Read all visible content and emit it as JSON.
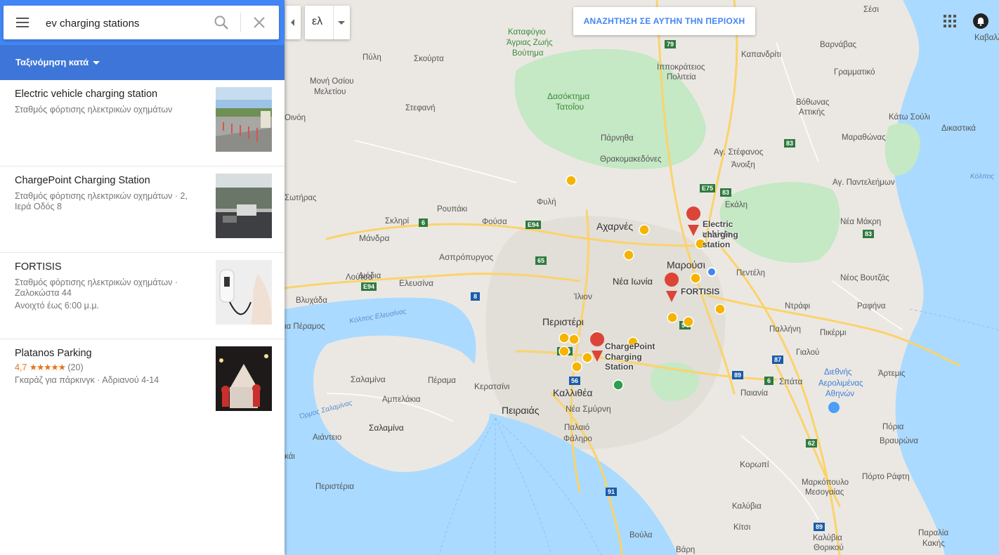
{
  "search": {
    "value": "ev charging stations"
  },
  "sort": {
    "label": "Ταξινόμηση κατά"
  },
  "results": [
    {
      "title": "Electric vehicle charging station",
      "line1": "Σταθμός φόρτισης ηλεκτρικών οχημάτων",
      "line2": "",
      "line3": ""
    },
    {
      "title": "ChargePoint Charging Station",
      "line1": "Σταθμός φόρτισης ηλεκτρικών οχημάτων · 2,",
      "line2": "Ιερά Οδός 8",
      "line3": ""
    },
    {
      "title": "FORTISIS",
      "line1": "Σταθμός φόρτισης ηλεκτρικών οχημάτων ·",
      "line2": "Ζαλοκώστα 44",
      "line3": "Ανοιχτό έως 6:00 μ.μ."
    },
    {
      "title": "Platanos Parking",
      "rating": "4,7",
      "stars": "★★★★★",
      "reviews": "(20)",
      "line2": "Γκαράζ για πάρκινγκ · Αδριανού 4-14"
    }
  ],
  "map": {
    "lang_label": "ελ",
    "search_area_label": "ΑΝΑΖΗΤΗΣΗ ΣΕ ΑΥΤΗΝ ΤΗΝ ΠΕΡΙΟΧΗ",
    "markers": {
      "ev_station": "Electric vehicle",
      "ev_station_2": "charging station",
      "fortisis": "FORTISIS",
      "chargepoint": "ChargePoint",
      "chargepoint_2": "Charging Station"
    },
    "labels": {
      "seisi": "Σέσι",
      "kavallari": "Καβαλλα",
      "katafygio1": "Καταφύγιο",
      "katafygio2": "Άγριας Ζωής",
      "katafygio3": "Βούτημα",
      "varnavas": "Βαρνάβας",
      "pyli": "Πύλη",
      "skourta": "Σκούρτα",
      "ippokratios1": "Ιπποκράτειος",
      "ippokratios2": "Πολιτεία",
      "kapandriti": "Καπανδρίτι",
      "grammatiko": "Γραμματικό",
      "moni1": "Μονή Οσίου",
      "moni2": "Μελετίου",
      "dasos1": "Δασόκτημα",
      "dasos2": "Τατοΐου",
      "vothonas1": "Βόθωνας",
      "vothonas2": "Αττικής",
      "oinoi": "Οινόη",
      "stefani": "Στεφανή",
      "kato_souli": "Κάτω Σούλι",
      "dikastika": "Δικαστικά",
      "parnitha": "Πάρνηθα",
      "marathonas": "Μαραθώνας",
      "thrakomakedones": "Θρακομακεδόνες",
      "ag_stefanos": "Αγ. Στέφανος",
      "anoixi": "Άνοιξη",
      "kolpos": "Κόλπος",
      "ag_panteleimon": "Αγ. Παντελεήμων",
      "sotiras": "Σωτήρας",
      "fyli": "Φυλή",
      "ekali": "Εκάλη",
      "roupaki": "Ρουπάκι",
      "skliri": "Σκληρί",
      "fousa": "Φούσα",
      "nea_makri": "Νέα Μάκρη",
      "acharnes": "Αχαρνές",
      "mandra": "Μάνδρα",
      "aspropyrgos": "Ασπρόπυργος",
      "marousi": "Μαρούσι",
      "penteli": "Πεντέλη",
      "loutsa": "Λούτσα",
      "diodia": "Διόδια",
      "nea_ionia": "Νέα Ιωνία",
      "elefsina": "Ελευσίνα",
      "neos_voutzas": "Νέος Βουτζάς",
      "vlychada": "Βλυχάδα",
      "ilion": "Ίλιον",
      "ntrafi": "Ντράφι",
      "rafina": "Ραφήνα",
      "kolpos_elef": "Κόλπος Ελευσίνας",
      "peramos": "ια Πέραμος",
      "peristeri": "Περιστέρι",
      "pallini": "Παλλήνη",
      "pikermi": "Πικέρμι",
      "gialou": "Γιαλού",
      "diethnis1": "Διεθνής",
      "diethnis2": "Αερολιμένας",
      "diethnis3": "Αθηνών",
      "artemis": "Άρτεμις",
      "salamina1": "Σαλαμίνα",
      "perama": "Πέραμα",
      "keratsini": "Κερατσίνι",
      "kallithea": "Καλλιθέα",
      "spata": "Σπάτα",
      "ampelakia": "Αμπελάκια",
      "paiania": "Παιανία",
      "nea_smyrni": "Νέα Σμύρνη",
      "peiraias": "Πειραιάς",
      "ormos": "Όρμος Σαλαμίνας",
      "salamina2": "Σαλαμίνα",
      "palaio1": "Παλαιό",
      "palaio2": "Φάληρο",
      "poria": "Πόρια",
      "vravrona": "Βραυρώνα",
      "aiantio": "Αιάντειο",
      "kaki": "κάι",
      "koropi": "Κορωπί",
      "porto_rafti": "Πόρτο Ράφτη",
      "markopoulo1": "Μαρκόπουλο",
      "markopoulo2": "Μεσογαίας",
      "peristeria": "Περιστέρια",
      "kalyvia": "Καλύβια",
      "kitsi": "Κίτσι",
      "paralia1": "Παραλία",
      "paralia2": "Κακής",
      "voula": "Βούλα",
      "kalyvia2a": "Καλύβια",
      "kalyvia2b": "Θορικού",
      "vari": "Βάρη"
    },
    "shields": {
      "r79": "79",
      "r83a": "83",
      "r83b": "83",
      "r83c": "83",
      "r83d": "83",
      "e75a": "E75",
      "e75b": "E75",
      "r6a": "6",
      "r6b": "6",
      "e94a": "E94",
      "e94b": "E94",
      "r65": "65",
      "r8": "8",
      "r54": "54",
      "r87": "87",
      "r89a": "89",
      "r89b": "89",
      "r56": "56",
      "r62": "62",
      "r91": "91"
    }
  },
  "colors": {
    "accent": "#4285f4",
    "water": "#aadaff",
    "park": "#c5e8c5",
    "road": "#fbd36b",
    "marker_red": "#db4437",
    "marker_yellow": "#f4b400"
  },
  "icons": [
    "menu-icon",
    "search-icon",
    "close-icon",
    "chevron-left-icon",
    "caret-down-icon",
    "apps-icon",
    "notifications-icon"
  ]
}
